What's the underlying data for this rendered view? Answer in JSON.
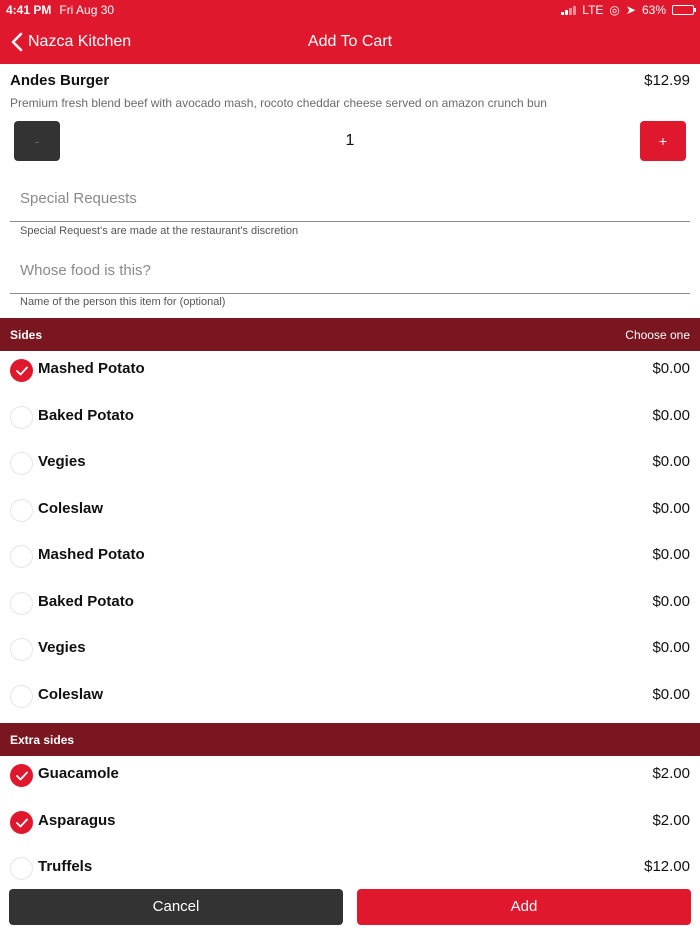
{
  "status_bar": {
    "time": "4:41 PM",
    "date": "Fri Aug 30",
    "network": "LTE",
    "battery": "63%",
    "battery_level": 0.63
  },
  "nav": {
    "back_label": "Nazca Kitchen",
    "title": "Add To Cart"
  },
  "item": {
    "name": "Andes Burger",
    "price": "$12.99",
    "description": "Premium fresh blend beef with avocado mash, rocoto cheddar cheese served on amazon crunch bun"
  },
  "quantity": {
    "minus_label": "-",
    "value": "1",
    "plus_label": "+"
  },
  "special_requests": {
    "placeholder": "Special Requests",
    "value": "",
    "hint": "Special Request's are made at the restaurant's discretion"
  },
  "whose_food": {
    "placeholder": "Whose food is this?",
    "value": "",
    "hint": "Name of the person this item for (optional)"
  },
  "sides": {
    "title": "Sides",
    "subtitle": "Choose one",
    "options": [
      {
        "label": "Mashed Potato",
        "price": "$0.00",
        "checked": true
      },
      {
        "label": "Baked Potato",
        "price": "$0.00",
        "checked": false
      },
      {
        "label": "Vegies",
        "price": "$0.00",
        "checked": false
      },
      {
        "label": "Coleslaw",
        "price": "$0.00",
        "checked": false
      },
      {
        "label": "Mashed Potato",
        "price": "$0.00",
        "checked": false
      },
      {
        "label": "Baked Potato",
        "price": "$0.00",
        "checked": false
      },
      {
        "label": "Vegies",
        "price": "$0.00",
        "checked": false
      },
      {
        "label": "Coleslaw",
        "price": "$0.00",
        "checked": false
      }
    ]
  },
  "extra_sides": {
    "title": "Extra sides",
    "options": [
      {
        "label": "Guacamole",
        "price": "$2.00",
        "checked": true
      },
      {
        "label": "Asparagus",
        "price": "$2.00",
        "checked": true
      },
      {
        "label": "Truffels",
        "price": "$12.00",
        "checked": false
      }
    ]
  },
  "actions": {
    "cancel_label": "Cancel",
    "add_label": "Add"
  },
  "colors": {
    "brand_red": "#e0182d",
    "section_header": "#7a1620",
    "dark_button": "#333333"
  }
}
